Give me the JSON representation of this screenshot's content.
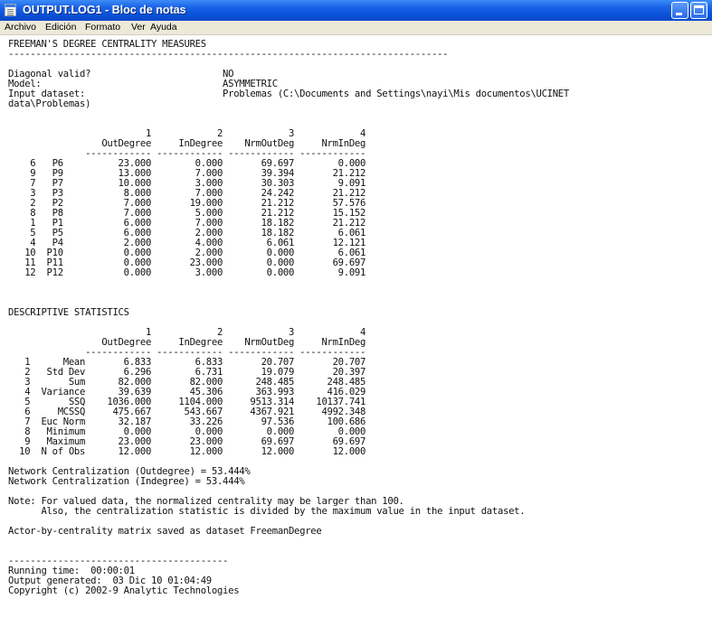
{
  "window": {
    "title": "OUTPUT.LOG1 - Bloc de notas"
  },
  "menu": [
    "Archivo",
    "Edición",
    "Formato",
    "Ver",
    "Ayuda"
  ],
  "lines": [
    "FREEMAN'S DEGREE CENTRALITY MEASURES",
    "--------------------------------------------------------------------------------",
    "",
    "Diagonal valid?                        NO",
    "Model:                                 ASYMMETRIC",
    "Input dataset:                         Problemas (C:\\Documents and Settings\\nayi\\Mis documentos\\UCINET",
    "data\\Problemas)",
    "",
    "",
    "                         1            2            3            4",
    "                 OutDegree     InDegree    NrmOutDeg     NrmInDeg",
    "              ------------ ------------ ------------ ------------",
    "    6   P6          23.000        0.000       69.697        0.000",
    "    9   P9          13.000        7.000       39.394       21.212",
    "    7   P7          10.000        3.000       30.303        9.091",
    "    3   P3           8.000        7.000       24.242       21.212",
    "    2   P2           7.000       19.000       21.212       57.576",
    "    8   P8           7.000        5.000       21.212       15.152",
    "    1   P1           6.000        7.000       18.182       21.212",
    "    5   P5           6.000        2.000       18.182        6.061",
    "    4   P4           2.000        4.000        6.061       12.121",
    "   10  P10           0.000        2.000        0.000        6.061",
    "   11  P11           0.000       23.000        0.000       69.697",
    "   12  P12           0.000        3.000        0.000        9.091",
    "",
    "",
    "",
    "DESCRIPTIVE STATISTICS",
    "",
    "                         1            2            3            4",
    "                 OutDegree     InDegree    NrmOutDeg     NrmInDeg",
    "              ------------ ------------ ------------ ------------",
    "   1      Mean       6.833        6.833       20.707       20.707",
    "   2   Std Dev       6.296        6.731       19.079       20.397",
    "   3       Sum      82.000       82.000      248.485      248.485",
    "   4  Variance      39.639       45.306      363.993      416.029",
    "   5       SSQ    1036.000     1104.000     9513.314    10137.741",
    "   6     MCSSQ     475.667      543.667     4367.921     4992.348",
    "   7  Euc Norm      32.187       33.226       97.536      100.686",
    "   8   Minimum       0.000        0.000        0.000        0.000",
    "   9   Maximum      23.000       23.000       69.697       69.697",
    "  10  N of Obs      12.000       12.000       12.000       12.000",
    "",
    "Network Centralization (Outdegree) = 53.444%",
    "Network Centralization (Indegree) = 53.444%",
    "",
    "Note: For valued data, the normalized centrality may be larger than 100.",
    "      Also, the centralization statistic is divided by the maximum value in the input dataset.",
    "",
    "Actor-by-centrality matrix saved as dataset FreemanDegree",
    "",
    "",
    "----------------------------------------",
    "Running time:  00:00:01",
    "Output generated:  03 Dic 10 01:04:49",
    "Copyright (c) 2002-9 Analytic Technologies"
  ]
}
